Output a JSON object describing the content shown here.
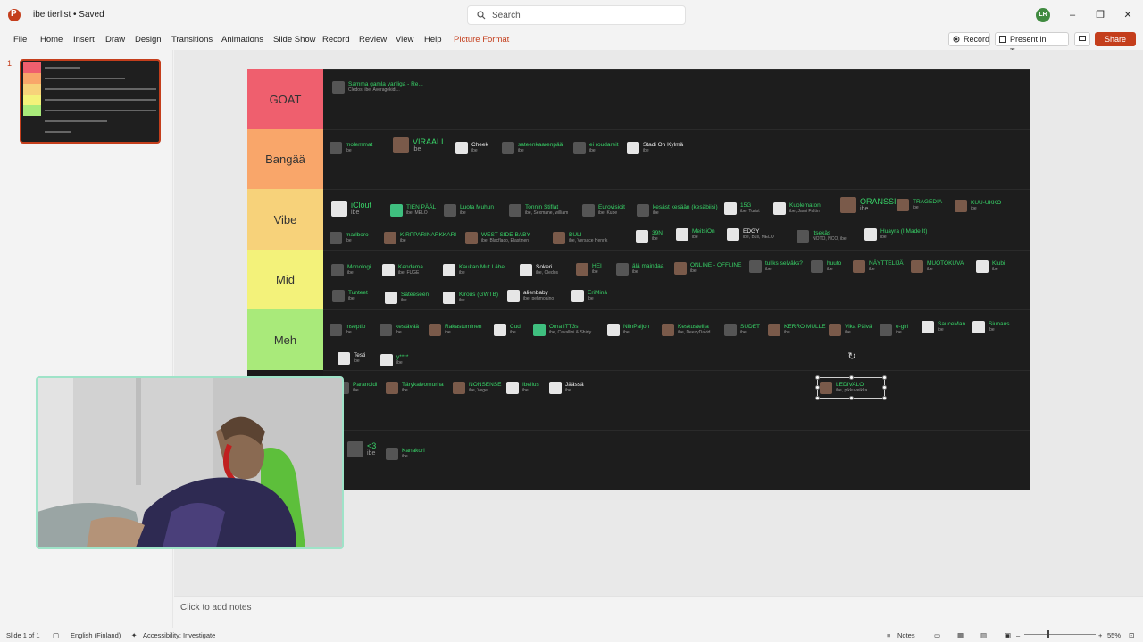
{
  "window": {
    "title": "ibe tierlist • Saved",
    "search_placeholder": "Search",
    "avatar_initials": "LR"
  },
  "menu": [
    "File",
    "Home",
    "Insert",
    "Draw",
    "Design",
    "Transitions",
    "Animations",
    "Slide Show",
    "Record",
    "Review",
    "View",
    "Help",
    "Picture Format"
  ],
  "ribbon_buttons": {
    "record": "Record",
    "present": "Present in Teams",
    "share": "Share"
  },
  "slides_pane": {
    "current_number": "1"
  },
  "tiers": [
    {
      "label": "GOAT",
      "color": "#ef5f6e"
    },
    {
      "label": "Bangää",
      "color": "#f9a66a"
    },
    {
      "label": "Vibe",
      "color": "#f7d27a"
    },
    {
      "label": "Mid",
      "color": "#f3f27a"
    },
    {
      "label": "Meh",
      "color": "#a9ea7a"
    }
  ],
  "cards": [
    {
      "name": "Samma gamla vanliga - Re...",
      "artist": "Cledos, ibe, Averagekidi..."
    },
    {
      "name": "molemmat",
      "artist": "ibe"
    },
    {
      "name": "VIRAALI",
      "artist": "ibe"
    },
    {
      "name": "Cheek",
      "artist": "ibe"
    },
    {
      "name": "sateenkaarenpää",
      "artist": "ibe"
    },
    {
      "name": "ei roudareit",
      "artist": "ibe"
    },
    {
      "name": "Stadi On Kylmä",
      "artist": "ibe"
    },
    {
      "name": "iClout",
      "artist": "ibe"
    },
    {
      "name": "TIEN PÄÄL",
      "artist": "ibe, MELO"
    },
    {
      "name": "Luota Muhun",
      "artist": "ibe"
    },
    {
      "name": "Tonnin Stiflat",
      "artist": "ibe, Sexmane, william"
    },
    {
      "name": "Eurovisioit",
      "artist": "ibe, Kube"
    },
    {
      "name": "kesäst kesään (kesäbiisi)",
      "artist": "ibe"
    },
    {
      "name": "15G",
      "artist": "ibe, Turist"
    },
    {
      "name": "Kuolematon",
      "artist": "ibe, Jami Faltin"
    },
    {
      "name": "ORANSSI",
      "artist": "ibe"
    },
    {
      "name": "TRAGEDIA",
      "artist": "ibe"
    },
    {
      "name": "KUU-UKKO",
      "artist": "ibe"
    },
    {
      "name": "marlboro",
      "artist": "ibe"
    },
    {
      "name": "KIRPPARINARKKARI",
      "artist": "ibe"
    },
    {
      "name": "WEST SIDE BABY",
      "artist": "ibe, Blacflaco, Elastinen"
    },
    {
      "name": "BULI",
      "artist": "ibe, Versace Henrik"
    },
    {
      "name": "39N",
      "artist": "ibe"
    },
    {
      "name": "MeitsiOn",
      "artist": "ibe"
    },
    {
      "name": "EDGY",
      "artist": "ibe, Buli, MELO"
    },
    {
      "name": "itsekäs",
      "artist": "NOTO, NCO, ibe"
    },
    {
      "name": "Huayra (I Made It)",
      "artist": "ibe"
    },
    {
      "name": "Monologi",
      "artist": "ibe"
    },
    {
      "name": "Kendama",
      "artist": "ibe, FUGE"
    },
    {
      "name": "Kaukan Mut Lähel",
      "artist": "ibe"
    },
    {
      "name": "Sokeri",
      "artist": "ibe, Cledos"
    },
    {
      "name": "HEI",
      "artist": "ibe"
    },
    {
      "name": "älä maindaa",
      "artist": "ibe"
    },
    {
      "name": "ONLINE - OFFLINE",
      "artist": "ibe"
    },
    {
      "name": "tuliks selväks?",
      "artist": "ibe"
    },
    {
      "name": "huuto",
      "artist": "ibe"
    },
    {
      "name": "NÄYTTELIJÄ",
      "artist": "ibe"
    },
    {
      "name": "MUOTOKUVA",
      "artist": "ibe"
    },
    {
      "name": "Klubi",
      "artist": "ibe"
    },
    {
      "name": "Tunteet",
      "artist": "ibe"
    },
    {
      "name": "Sateeseen",
      "artist": "ibe"
    },
    {
      "name": "Kirous (GWTB)",
      "artist": "ibe"
    },
    {
      "name": "alienbaby",
      "artist": "ibe, pehmoaino"
    },
    {
      "name": "EriMinä",
      "artist": "ibe"
    },
    {
      "name": "inseptio",
      "artist": "ibe"
    },
    {
      "name": "kestävää",
      "artist": "ibe"
    },
    {
      "name": "Rakastuminen",
      "artist": "ibe"
    },
    {
      "name": "Cudi",
      "artist": "ibe"
    },
    {
      "name": "Oma ITT3s",
      "artist": "ibe, Cavallini & Shirty"
    },
    {
      "name": "NiinPaljon",
      "artist": "ibe"
    },
    {
      "name": "Keskustelija",
      "artist": "ibe, DeezyDavid"
    },
    {
      "name": "SUDET",
      "artist": "ibe"
    },
    {
      "name": "KERRO MULLE",
      "artist": "ibe"
    },
    {
      "name": "Vika Päivä",
      "artist": "ibe"
    },
    {
      "name": "e-girl",
      "artist": "ibe"
    },
    {
      "name": "SauceMan",
      "artist": "ibe"
    },
    {
      "name": "Siunaus",
      "artist": "ibe"
    },
    {
      "name": "Testi",
      "artist": "ibe"
    },
    {
      "name": "y****",
      "artist": "ibe"
    },
    {
      "name": "Paranoidi",
      "artist": "ibe"
    },
    {
      "name": "Tärykalvomurha",
      "artist": "ibe"
    },
    {
      "name": "NONSENSE",
      "artist": "ibe, Vege"
    },
    {
      "name": "Ibelius",
      "artist": "ibe"
    },
    {
      "name": "Jäässä",
      "artist": "ibe"
    },
    {
      "name": "<3",
      "artist": "ibe"
    },
    {
      "name": "Kanakori",
      "artist": "ibe"
    },
    {
      "name": "LEDIVALO",
      "artist": "ibe, pikkuveikka"
    }
  ],
  "notes_placeholder": "Click to add notes",
  "status": {
    "slide": "Slide 1 of 1",
    "language": "English (Finland)",
    "accessibility": "Accessibility: Investigate",
    "notes": "Notes",
    "zoom": "55%"
  }
}
